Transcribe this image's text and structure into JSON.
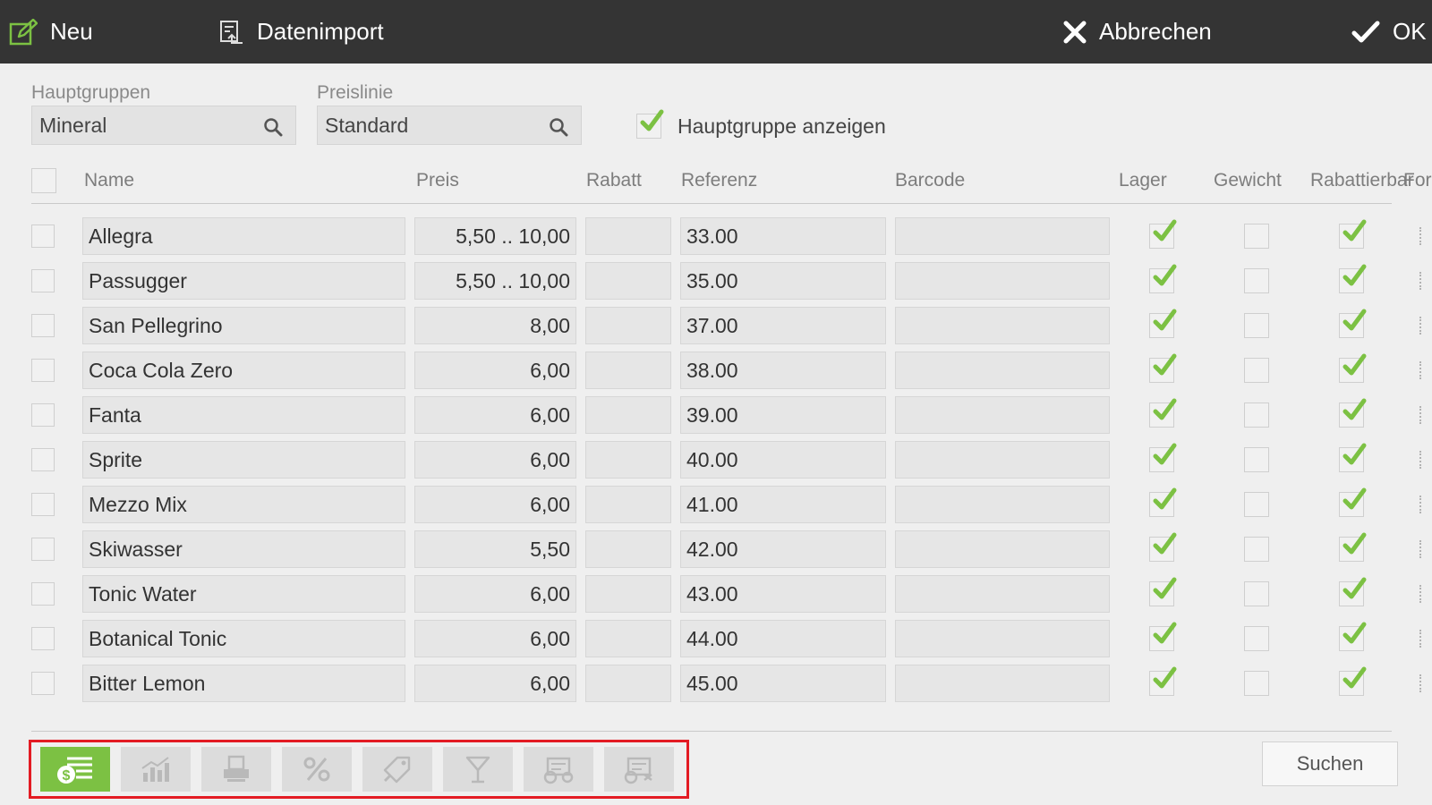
{
  "toolbar": {
    "new_label": "Neu",
    "import_label": "Datenimport",
    "cancel_label": "Abbrechen",
    "ok_label": "OK"
  },
  "filters": {
    "main_group_label": "Hauptgruppen",
    "main_group_value": "Mineral",
    "price_line_label": "Preislinie",
    "price_line_value": "Standard",
    "show_main_group_label": "Hauptgruppe anzeigen",
    "show_main_group_checked": true
  },
  "table": {
    "columns": [
      "Name",
      "Preis",
      "Rabatt",
      "Referenz",
      "Barcode",
      "Lager",
      "Gewicht",
      "Rabattierbar",
      "For"
    ],
    "rows": [
      {
        "name": "Allegra",
        "price": "5,50 .. 10,00",
        "discount": "",
        "reference": "33.00",
        "barcode": "",
        "stock": true,
        "weight": false,
        "discountable": true
      },
      {
        "name": "Passugger",
        "price": "5,50 .. 10,00",
        "discount": "",
        "reference": "35.00",
        "barcode": "",
        "stock": true,
        "weight": false,
        "discountable": true
      },
      {
        "name": "San Pellegrino",
        "price": "8,00",
        "discount": "",
        "reference": "37.00",
        "barcode": "",
        "stock": true,
        "weight": false,
        "discountable": true
      },
      {
        "name": "Coca Cola Zero",
        "price": "6,00",
        "discount": "",
        "reference": "38.00",
        "barcode": "",
        "stock": true,
        "weight": false,
        "discountable": true
      },
      {
        "name": "Fanta",
        "price": "6,00",
        "discount": "",
        "reference": "39.00",
        "barcode": "",
        "stock": true,
        "weight": false,
        "discountable": true
      },
      {
        "name": "Sprite",
        "price": "6,00",
        "discount": "",
        "reference": "40.00",
        "barcode": "",
        "stock": true,
        "weight": false,
        "discountable": true
      },
      {
        "name": "Mezzo Mix",
        "price": "6,00",
        "discount": "",
        "reference": "41.00",
        "barcode": "",
        "stock": true,
        "weight": false,
        "discountable": true
      },
      {
        "name": "Skiwasser",
        "price": "5,50",
        "discount": "",
        "reference": "42.00",
        "barcode": "",
        "stock": true,
        "weight": false,
        "discountable": true
      },
      {
        "name": "Tonic Water",
        "price": "6,00",
        "discount": "",
        "reference": "43.00",
        "barcode": "",
        "stock": true,
        "weight": false,
        "discountable": true
      },
      {
        "name": "Botanical Tonic",
        "price": "6,00",
        "discount": "",
        "reference": "44.00",
        "barcode": "",
        "stock": true,
        "weight": false,
        "discountable": true
      },
      {
        "name": "Bitter Lemon",
        "price": "6,00",
        "discount": "",
        "reference": "45.00",
        "barcode": "",
        "stock": true,
        "weight": false,
        "discountable": true
      }
    ]
  },
  "bottom_tabs": [
    {
      "icon": "price-list-icon",
      "active": true
    },
    {
      "icon": "chart-icon",
      "active": false
    },
    {
      "icon": "printer-icon",
      "active": false
    },
    {
      "icon": "percent-icon",
      "active": false
    },
    {
      "icon": "tag-icon",
      "active": false
    },
    {
      "icon": "cocktail-icon",
      "active": false
    },
    {
      "icon": "money-settings-icon",
      "active": false
    },
    {
      "icon": "money-settings-alt-icon",
      "active": false
    }
  ],
  "search_label": "Suchen",
  "colors": {
    "topbar": "#343434",
    "accent_green": "#7cc143",
    "highlight_red": "#e31b23"
  }
}
